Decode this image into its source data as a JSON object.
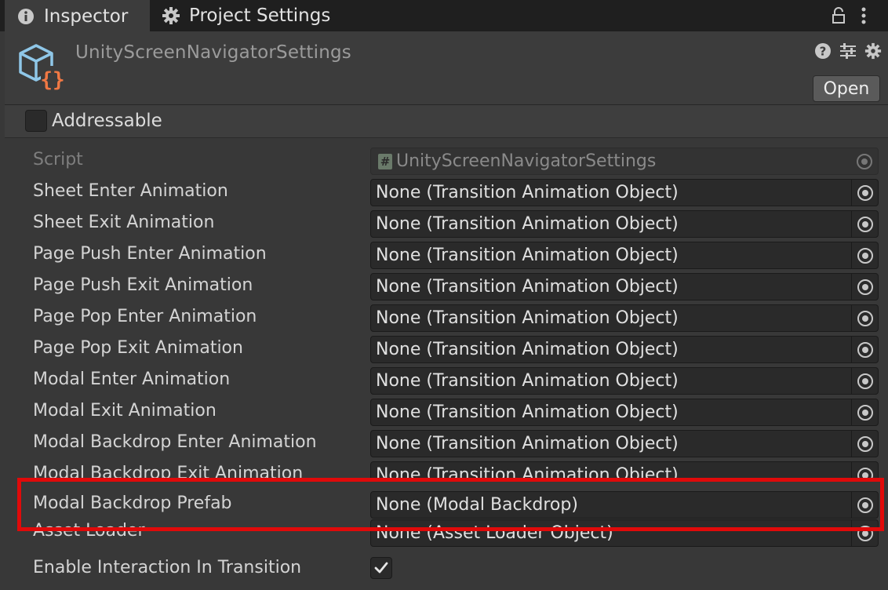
{
  "tabs": [
    {
      "label": "Inspector",
      "icon": "info-icon"
    },
    {
      "label": "Project Settings",
      "icon": "gear-icon"
    }
  ],
  "tab_bar_icons": [
    "lock-icon",
    "more-vert-icon"
  ],
  "header": {
    "title": "UnityScreenNavigatorSettings",
    "icon": "scriptable-object-icon",
    "buttons": [
      "help-icon",
      "preset-sliders-icon",
      "settings-gear-icon"
    ],
    "open_label": "Open"
  },
  "addressable": {
    "label": "Addressable",
    "checked": false
  },
  "properties": [
    {
      "label": "Script",
      "value": "UnityScreenNavigatorSettings",
      "disabled": true
    },
    {
      "label": "Sheet Enter Animation",
      "value": "None (Transition Animation Object)"
    },
    {
      "label": "Sheet Exit Animation",
      "value": "None (Transition Animation Object)"
    },
    {
      "label": "Page Push Enter Animation",
      "value": "None (Transition Animation Object)"
    },
    {
      "label": "Page Push Exit Animation",
      "value": "None (Transition Animation Object)"
    },
    {
      "label": "Page Pop Enter Animation",
      "value": "None (Transition Animation Object)"
    },
    {
      "label": "Page Pop Exit Animation",
      "value": "None (Transition Animation Object)"
    },
    {
      "label": "Modal Enter Animation",
      "value": "None (Transition Animation Object)"
    },
    {
      "label": "Modal Exit Animation",
      "value": "None (Transition Animation Object)"
    },
    {
      "label": "Modal Backdrop Enter Animation",
      "value": "None (Transition Animation Object)"
    },
    {
      "label": "Modal Backdrop Exit Animation",
      "value": "None (Transition Animation Object)"
    },
    {
      "label": "Modal Backdrop Prefab",
      "value": "None (Modal Backdrop)"
    },
    {
      "label": "Asset Loader",
      "value": "None (Asset Loader Object)"
    }
  ],
  "enable_interaction": {
    "label": "Enable Interaction In Transition",
    "checked": true
  },
  "colors": {
    "background": "#383838",
    "tabbar": "#1f1f1f",
    "field": "#2a2a2a",
    "highlight": "#e00a0a",
    "icon_blue": "#8fc7e8",
    "icon_orange": "#f07844"
  }
}
